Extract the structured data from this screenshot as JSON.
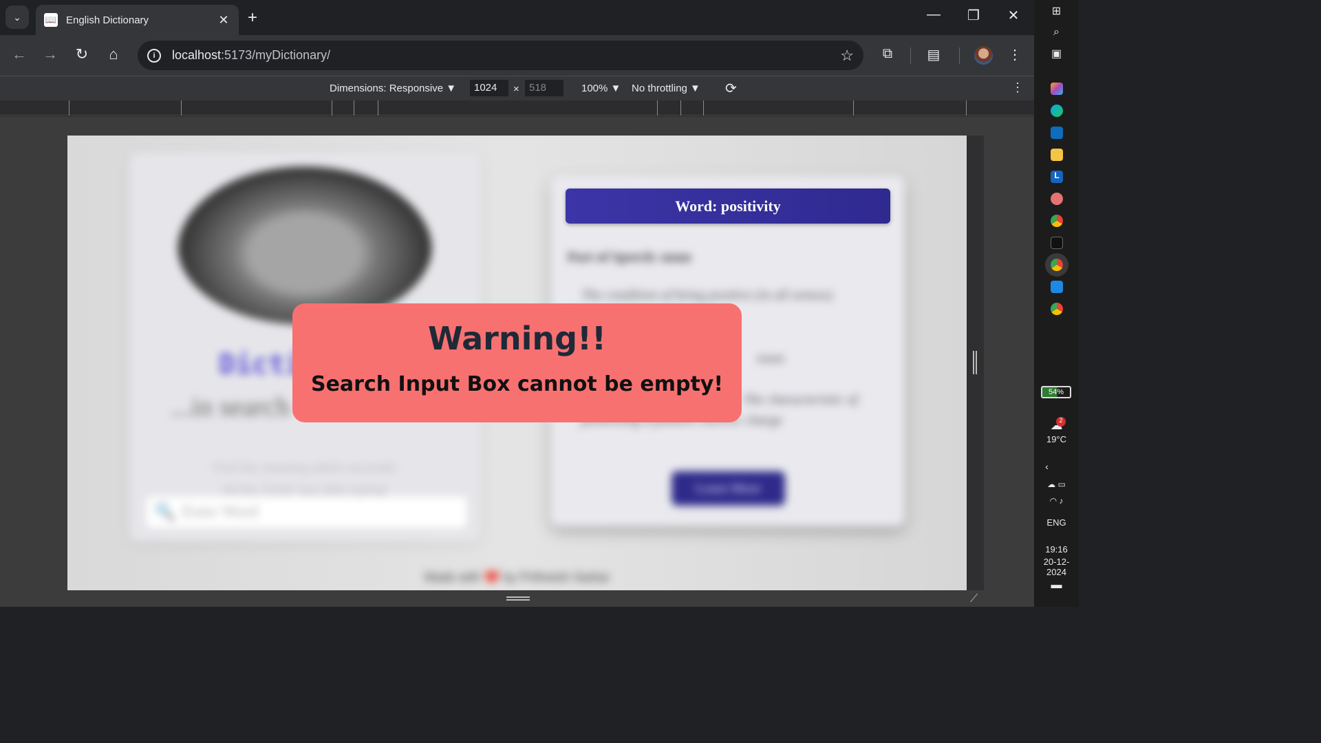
{
  "browser": {
    "tab_title": "English Dictionary",
    "tab_close": "✕",
    "new_tab": "+",
    "url_host": "localhost",
    "url_rest": ":5173/myDictionary/"
  },
  "devtools": {
    "dimensions_label": "Dimensions: Responsive ▼",
    "width": "1024",
    "x_sep": "×",
    "height": "518",
    "zoom": "100% ▼",
    "throttle": "No throttling ▼"
  },
  "page": {
    "dict_title": "Dicti",
    "dict_subtitle": "...in search",
    "hint1": "Find the meaning within seconds!",
    "hint2": "Hit the 'Enter' key after typing!",
    "search_placeholder": "Enter Word",
    "word_header": "Word: positivity",
    "part_of_speech": "Part of Speech: noun",
    "def1": "The condition of being positive (in all senses).",
    "def2": "noun",
    "def3": "The characteristic of",
    "def4": "possessing a positive electric charge",
    "learn_more": "Learn More",
    "footer": "Made with ❤️ by Prithwish Sarkar"
  },
  "modal": {
    "title": "Warning!!",
    "message": "Search Input Box cannot be empty!"
  },
  "taskbar": {
    "battery": "54%",
    "weather_badge": "2",
    "temperature": "19°C",
    "language": "ENG",
    "time": "19:16",
    "date": "20-12-2024"
  },
  "colors": {
    "warning_bg": "#f87171",
    "header_bg": "#3b35a8",
    "accent_purple": "#5b4fd6"
  }
}
